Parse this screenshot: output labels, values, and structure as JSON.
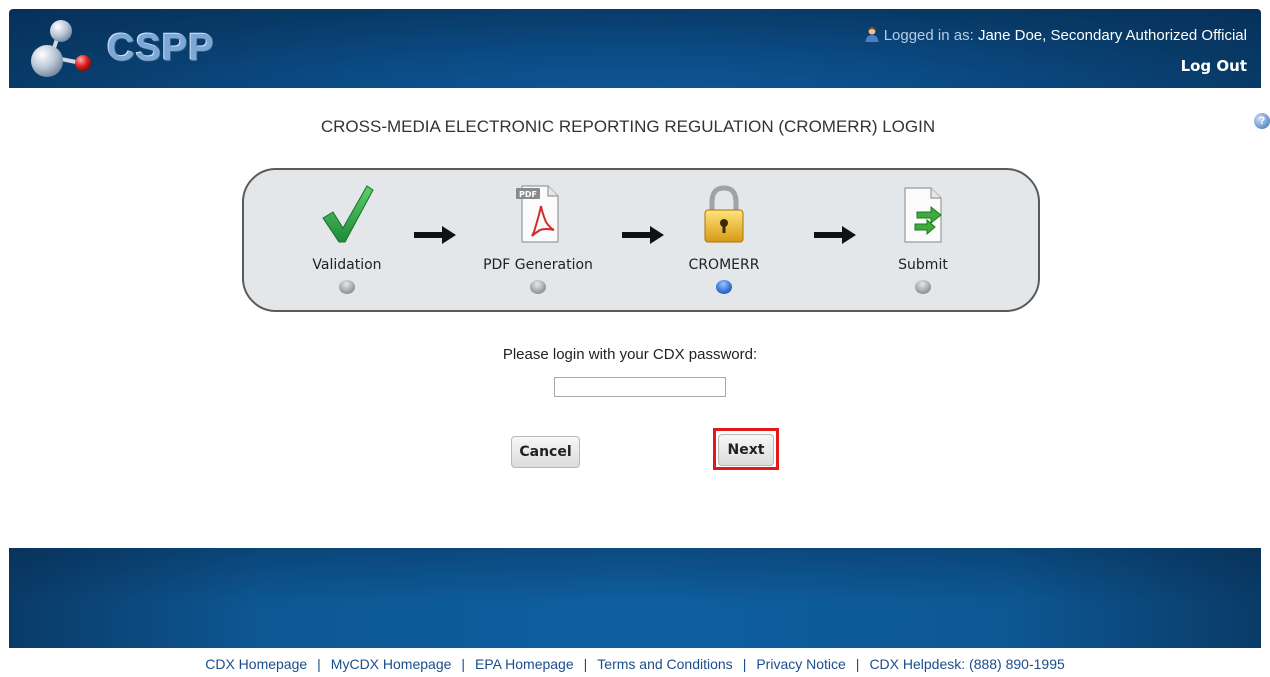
{
  "header": {
    "logo_text": "CSPP",
    "logged_in_prefix": "Logged in as:",
    "user_name": "Jane Doe, Secondary Authorized Official",
    "logout_label": "Log Out"
  },
  "page": {
    "title": "CROSS-MEDIA ELECTRONIC REPORTING REGULATION (CROMERR) LOGIN",
    "help_symbol": "?"
  },
  "stepper": {
    "steps": [
      {
        "label": "Validation",
        "icon": "checkmark-icon",
        "active": false
      },
      {
        "label": "PDF Generation",
        "icon": "pdf-document-icon",
        "active": false
      },
      {
        "label": "CROMERR",
        "icon": "padlock-icon",
        "active": true
      },
      {
        "label": "Submit",
        "icon": "submit-document-icon",
        "active": false
      }
    ],
    "pdf_badge": "PDF"
  },
  "form": {
    "prompt": "Please login with your CDX password:",
    "password_value": "",
    "cancel_label": "Cancel",
    "next_label": "Next"
  },
  "footer": {
    "links": [
      "CDX Homepage",
      "MyCDX Homepage",
      "EPA Homepage",
      "Terms and Conditions",
      "Privacy Notice",
      "CDX Helpdesk: (888) 890-1995"
    ],
    "separator": "|"
  },
  "colors": {
    "header_blue": "#0b4a84",
    "active_step": "#2e6fd0",
    "highlight": "#e01919",
    "link": "#1a4d8c"
  }
}
